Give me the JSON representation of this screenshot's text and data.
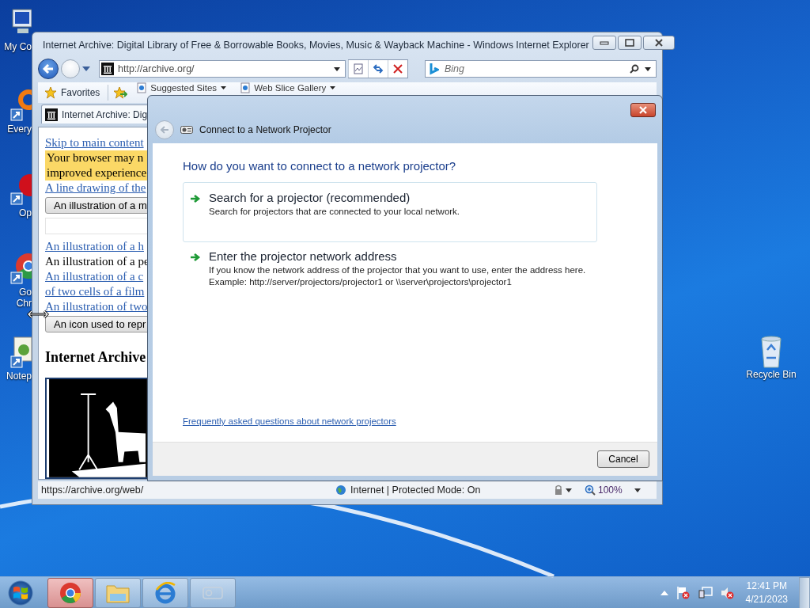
{
  "desktop": {
    "icons": [
      {
        "kind": "computer",
        "lines": [
          "My Co"
        ]
      },
      {
        "kind": "everything",
        "lines": [
          "Every"
        ]
      },
      {
        "kind": "opera",
        "lines": [
          "Op"
        ]
      },
      {
        "kind": "chrome",
        "lines": [
          "Go",
          "Chr"
        ]
      },
      {
        "kind": "notepad",
        "lines": [
          "Notep"
        ]
      },
      {
        "kind": "recycle",
        "lines": [
          "Recycle Bin"
        ]
      }
    ]
  },
  "browser": {
    "title": "Internet Archive: Digital Library of Free & Borrowable Books, Movies, Music & Wayback Machine - Windows Internet Explorer",
    "address": "http://archive.org/",
    "search": {
      "placeholder": "Bing"
    },
    "favorites": "Favorites",
    "links": [
      "Suggested Sites",
      "Web Slice Gallery"
    ],
    "tab": "Internet Archive: Dig",
    "page": [
      {
        "kind": "link",
        "text": "Skip to main content"
      },
      {
        "kind": "notice",
        "lines": [
          "Your browser may n",
          "improved experience"
        ]
      },
      {
        "kind": "link",
        "text": "A line drawing of the"
      },
      {
        "kind": "button",
        "text": "An illustration of a m"
      },
      {
        "kind": "input"
      },
      {
        "kind": "link",
        "text": "An illustration of a h"
      },
      {
        "kind": "text",
        "text": "An illustration of a pe"
      },
      {
        "kind": "link",
        "text": "An illustration of a c"
      },
      {
        "kind": "link",
        "text": "of two cells of a film"
      },
      {
        "kind": "link",
        "text": "An illustration of two"
      },
      {
        "kind": "button",
        "text": "An icon used to repr"
      },
      {
        "kind": "heading",
        "text": "Internet Archive"
      },
      {
        "kind": "image"
      }
    ],
    "status": {
      "url": "https://archive.org/web/",
      "zone": "Internet | Protected Mode: On",
      "zoom": "100%"
    }
  },
  "dialog": {
    "title": "Connect to a Network Projector",
    "question": "How do you want to connect to a network projector?",
    "options": [
      {
        "title": "Search for a projector (recommended)",
        "lines": [
          "Search for projectors that are connected to your local network."
        ],
        "selected": true
      },
      {
        "title": "Enter the projector network address",
        "lines": [
          "If you know the network address of the projector that you want to use, enter the address here.",
          "Example: http://server/projectors/projector1 or \\\\server\\projectors\\projector1"
        ],
        "selected": false
      }
    ],
    "help_link": "Frequently asked questions about network projectors",
    "cancel": "Cancel"
  },
  "taskbar": {
    "items": [
      {
        "kind": "chrome",
        "selected": true
      },
      {
        "kind": "folder",
        "selected": false
      },
      {
        "kind": "ie",
        "selected": false
      },
      {
        "kind": "network",
        "selected": false
      }
    ],
    "time": "12:41 PM",
    "date": "4/21/2023"
  }
}
